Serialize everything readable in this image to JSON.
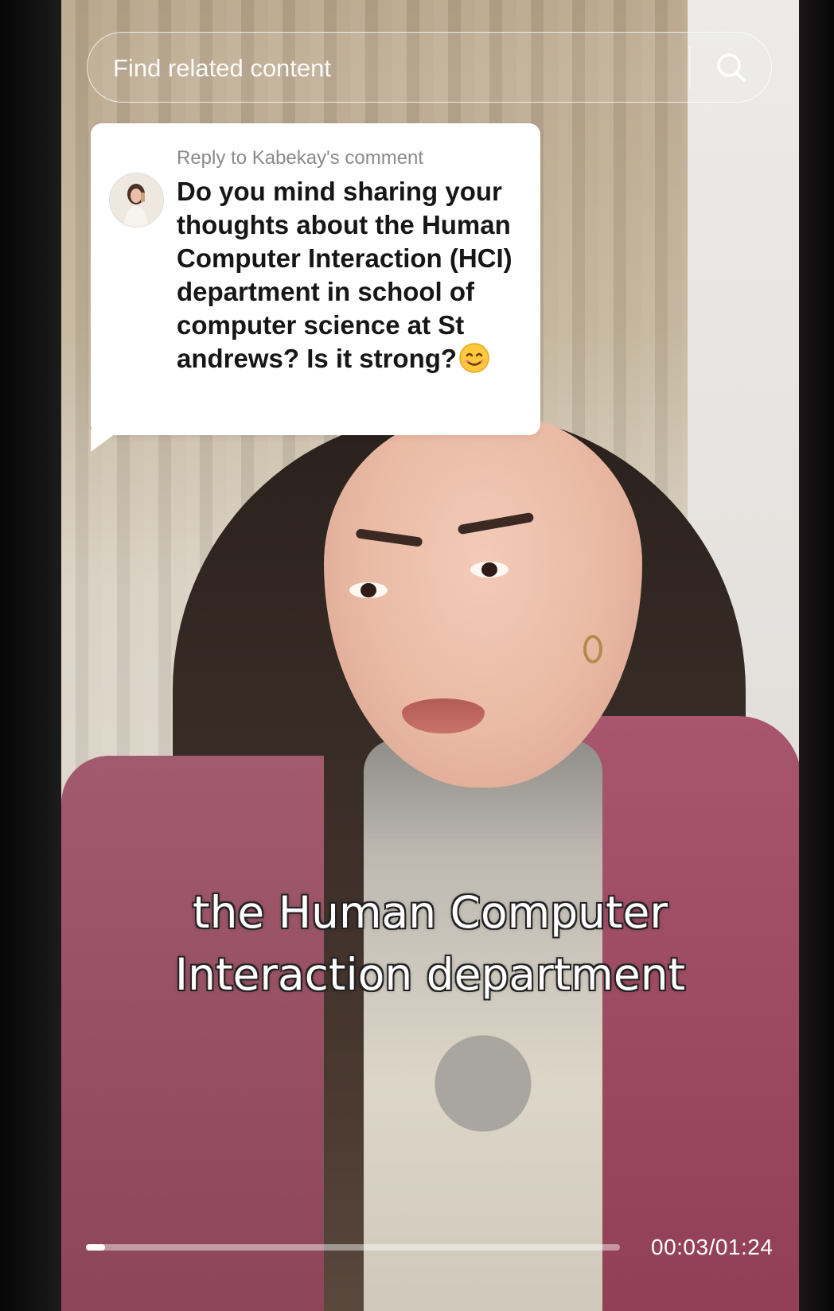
{
  "search": {
    "placeholder": "Find related content",
    "icon": "search-icon"
  },
  "comment": {
    "reply_label": "Reply to Kabekay's comment",
    "text": "Do you mind sharing your thoughts about the Human Computer Interaction (HCI) department in school of computer science at St andrews? Is it strong?",
    "emoji": "smiling-face-emoji"
  },
  "caption": {
    "line1": "the Human Computer",
    "line2": "Interaction department"
  },
  "player": {
    "time": "00:03/01:24",
    "progress_fraction": 0.036
  },
  "colors": {
    "card_bg": "#ffffff",
    "caption_text": "#ffffff",
    "shawl": "#a25a6e"
  }
}
